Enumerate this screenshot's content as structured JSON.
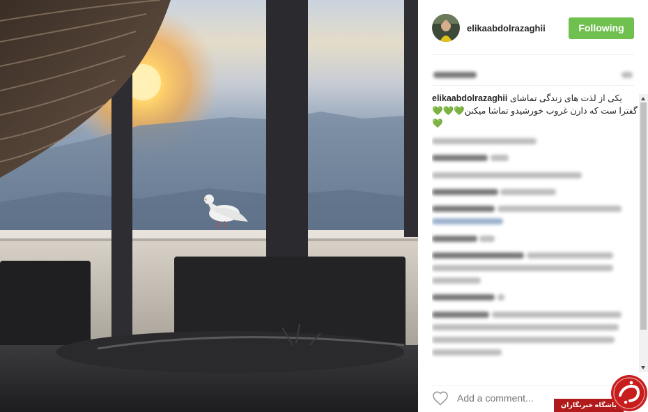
{
  "post": {
    "username": "elikaabdolrazaghii",
    "follow_label": "Following",
    "caption_user": "elikaabdolrazaghii",
    "caption_text": "یکی از لذت های زندگی تماشای گفترا ست که دارن غروب خورشیدو تماشا میکنن💚💚💚💚",
    "add_comment_placeholder": "Add a comment..."
  },
  "watermark": {
    "text": "باشگاه خبرنگاران"
  },
  "icons": {
    "like": "heart-icon",
    "watermark_logo": "yjc-logo-icon"
  },
  "colors": {
    "follow_button": "#70c050",
    "watermark_red": "#b11a1a",
    "text": "#262626",
    "placeholder": "#999999"
  }
}
